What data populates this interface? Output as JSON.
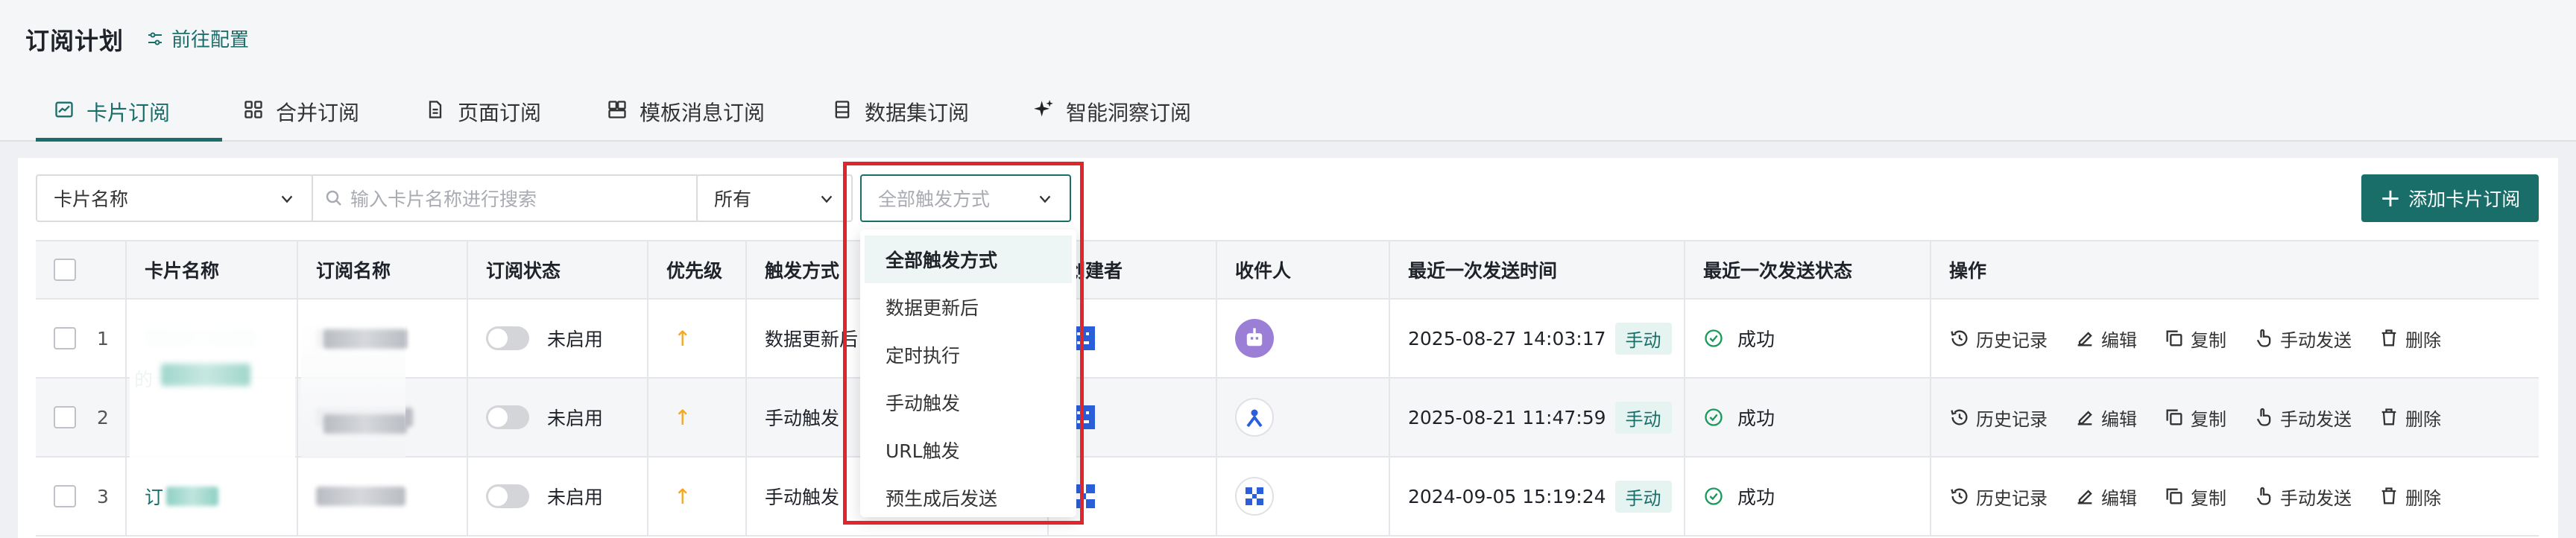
{
  "page": {
    "title": "订阅计划",
    "config_link": "前往配置"
  },
  "tabs": [
    {
      "label": "卡片订阅",
      "icon": "line-chart-icon",
      "active": true
    },
    {
      "label": "合并订阅",
      "icon": "grid-icon"
    },
    {
      "label": "页面订阅",
      "icon": "document-icon"
    },
    {
      "label": "模板消息订阅",
      "icon": "template-icon"
    },
    {
      "label": "数据集订阅",
      "icon": "dataset-icon"
    },
    {
      "label": "智能洞察订阅",
      "icon": "sparkle-icon"
    }
  ],
  "filters": {
    "field_select": "卡片名称",
    "search_placeholder": "输入卡片名称进行搜索",
    "status_select": "所有",
    "trigger_select_placeholder": "全部触发方式"
  },
  "add_button": "添加卡片订阅",
  "table": {
    "columns": [
      "卡片名称",
      "订阅名称",
      "订阅状态",
      "优先级",
      "触发方式",
      "创建者",
      "收件人",
      "最近一次发送时间",
      "最近一次发送状态",
      "操作"
    ],
    "rows": [
      {
        "index": "1",
        "status": "未启用",
        "priority": "↑",
        "trigger": "数据更新后",
        "last_time": "2025-08-27 14:03:17",
        "send_tag": "手动",
        "last_status": "成功"
      },
      {
        "index": "2",
        "status": "未启用",
        "priority": "↑",
        "trigger": "手动触发",
        "last_time": "2025-08-21 11:47:59",
        "send_tag": "手动",
        "last_status": "成功"
      },
      {
        "index": "3",
        "status": "未启用",
        "priority": "↑",
        "trigger": "手动触发",
        "last_time": "2024-09-05 15:19:24",
        "send_tag": "手动",
        "last_status": "成功"
      }
    ],
    "row_prefixes": {
      "row1": "的",
      "row3": "订"
    },
    "actions": [
      "历史记录",
      "编辑",
      "复制",
      "手动发送",
      "删除"
    ]
  },
  "dropdown": {
    "options": [
      "全部触发方式",
      "数据更新后",
      "定时执行",
      "手动触发",
      "URL触发",
      "预生成后发送"
    ],
    "selected_index": 0
  },
  "colors": {
    "accent": "#1a6e6a",
    "priority": "#f5a623",
    "highlight": "#e0262b",
    "avatar_blue": "#2b5fd9",
    "avatar_purple": "#9b7fd6"
  }
}
